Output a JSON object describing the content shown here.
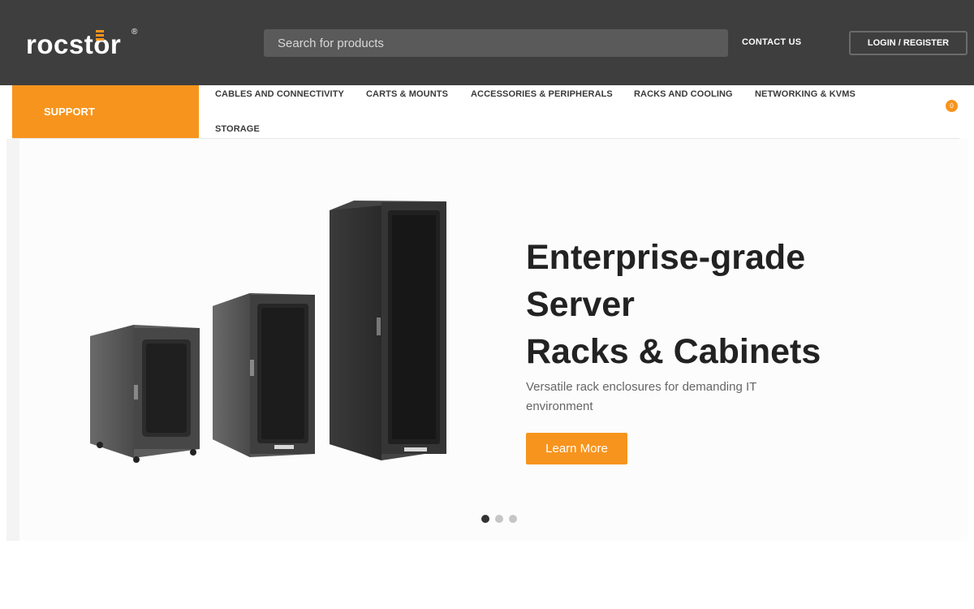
{
  "brand": {
    "name": "rocstor",
    "registered_mark": "®",
    "accent_color": "#f7941d"
  },
  "header": {
    "search_placeholder": "Search for products",
    "contact_label": "CONTACT US",
    "login_label": "LOGIN / REGISTER"
  },
  "nav": {
    "support_label": "SUPPORT",
    "items": [
      {
        "label": "CABLES AND CONNECTIVITY"
      },
      {
        "label": "CARTS & MOUNTS"
      },
      {
        "label": "ACCESSORIES & PERIPHERALS"
      },
      {
        "label": "RACKS AND COOLING"
      },
      {
        "label": "NETWORKING & KVMS"
      },
      {
        "label": "STORAGE"
      }
    ],
    "cart_count": "0"
  },
  "hero": {
    "headline_lines": [
      "Enterprise-grade",
      "Server",
      "Racks & Cabinets"
    ],
    "subtext": "Versatile rack enclosures for demanding IT environment",
    "cta_label": "Learn More",
    "slide_count": 3,
    "active_slide": 1
  }
}
